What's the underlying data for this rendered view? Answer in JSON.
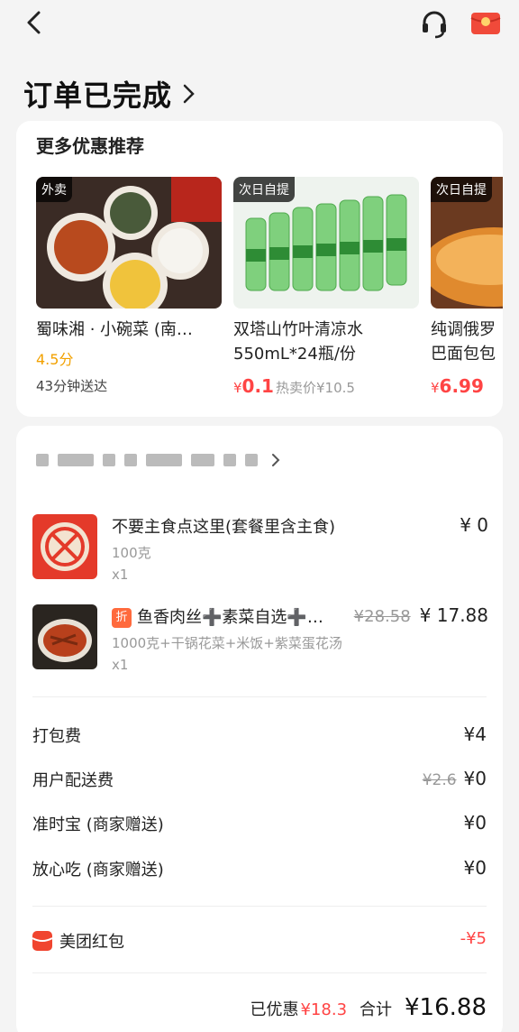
{
  "header": {
    "title": "订单已完成"
  },
  "promo": {
    "heading": "更多优惠推荐",
    "items": [
      {
        "tag": "外卖",
        "name": "蜀味湘 · 小碗菜 (南…",
        "rating": "4.5分",
        "eta": "43分钟送达"
      },
      {
        "tag": "次日自提",
        "name_line1": "双塔山竹叶清凉水",
        "name_line2": "550mL*24瓶/份",
        "yen": "¥",
        "price": "0.1",
        "hot_price": "热卖价¥10.5"
      },
      {
        "tag": "次日自提",
        "name_line1": "纯调俄罗",
        "name_line2": "巴面包包",
        "yen": "¥",
        "price": "6.99"
      }
    ]
  },
  "order": {
    "dishes": [
      {
        "name": "不要主食点这里(套餐里含主食)",
        "spec": "100克",
        "qty": "x1",
        "price": "¥ 0"
      },
      {
        "badge": "折",
        "name": "鱼香肉丝➕素菜自选➕…",
        "orig_price": "¥28.58",
        "price": "¥ 17.88",
        "spec": "1000克+干锅花菜+米饭+紫菜蛋花汤",
        "qty": "x1"
      }
    ],
    "fees": [
      {
        "label": "打包费",
        "value": "¥4"
      },
      {
        "label": "用户配送费",
        "orig": "¥2.6",
        "value": "¥0"
      },
      {
        "label": "准时宝 (商家赠送)",
        "value": "¥0"
      },
      {
        "label": "放心吃 (商家赠送)",
        "value": "¥0"
      }
    ],
    "redpacket": {
      "label": "美团红包",
      "value": "-¥5"
    },
    "summary": {
      "discount_label": "已优惠",
      "discount_value": "¥18.3",
      "total_label": "合计",
      "total_value": "¥16.88"
    }
  },
  "colors": {
    "accent_red": "#ff4444",
    "rating_yellow": "#f2a100",
    "badge_orange": "#ff6a3d"
  }
}
